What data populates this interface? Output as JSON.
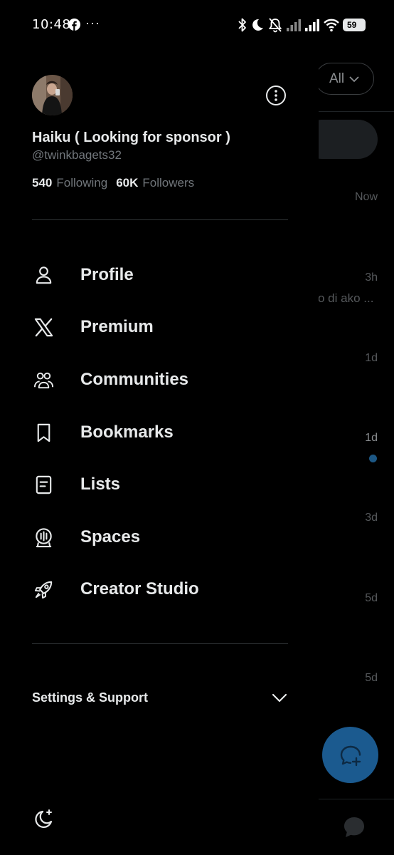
{
  "status_bar": {
    "time": "10:48",
    "dots": "···",
    "battery": "59"
  },
  "background": {
    "filter_label": "All",
    "times": [
      "Now",
      "3h",
      "1d",
      "1d",
      "3d",
      "5d",
      "5d"
    ],
    "snippet": "o di ako ..."
  },
  "drawer": {
    "profile": {
      "display_name": "Haiku ( Looking for sponsor )",
      "handle": "@twinkbagets32",
      "following_count": "540",
      "following_label": "Following",
      "followers_count": "60K",
      "followers_label": "Followers"
    },
    "menu": [
      {
        "label": "Profile",
        "icon": "person-icon"
      },
      {
        "label": "Premium",
        "icon": "x-logo-icon"
      },
      {
        "label": "Communities",
        "icon": "communities-icon"
      },
      {
        "label": "Bookmarks",
        "icon": "bookmark-icon"
      },
      {
        "label": "Lists",
        "icon": "list-icon"
      },
      {
        "label": "Spaces",
        "icon": "spaces-icon"
      },
      {
        "label": "Creator Studio",
        "icon": "rocket-icon"
      }
    ],
    "settings_label": "Settings & Support"
  },
  "colors": {
    "background": "#000000",
    "text_primary": "#e7e9ea",
    "text_secondary": "#71767b",
    "divider": "#2f3336",
    "fab": "#1b5a8f"
  }
}
